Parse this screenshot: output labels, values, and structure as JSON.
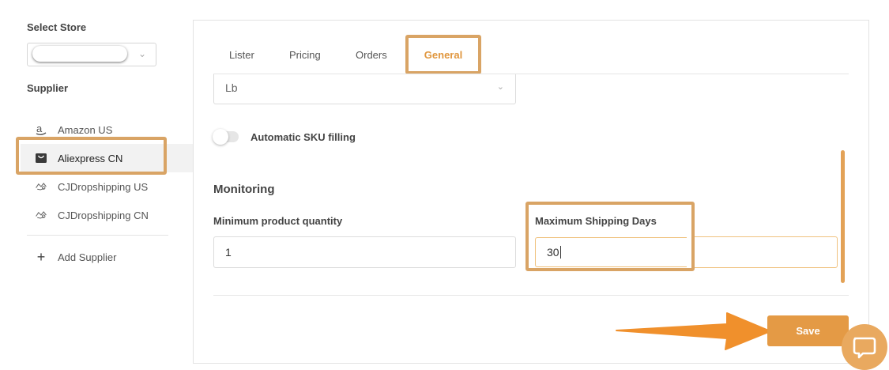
{
  "sidebar": {
    "select_store_label": "Select Store",
    "supplier_label": "Supplier",
    "items": [
      {
        "label": "Amazon US",
        "icon": "amazon-icon"
      },
      {
        "label": "Aliexpress CN",
        "icon": "aliexpress-icon"
      },
      {
        "label": "CJDropshipping US",
        "icon": "cjdropshipping-icon"
      },
      {
        "label": "CJDropshipping CN",
        "icon": "cjdropshipping-icon"
      }
    ],
    "add_supplier_label": "Add Supplier"
  },
  "tabs": [
    {
      "label": "Lister"
    },
    {
      "label": "Pricing"
    },
    {
      "label": "Orders"
    },
    {
      "label": "General"
    }
  ],
  "settings": {
    "weight_unit_value": "Lb",
    "auto_sku_label": "Automatic SKU filling",
    "monitoring_title": "Monitoring",
    "min_qty_label": "Minimum product quantity",
    "min_qty_value": "1",
    "max_shipping_label": "Maximum Shipping Days",
    "max_shipping_value": "30"
  },
  "save_label": "Save",
  "colors": {
    "accent": "#e49a45",
    "highlight": "#d9a465",
    "arrow": "#f0902c"
  }
}
